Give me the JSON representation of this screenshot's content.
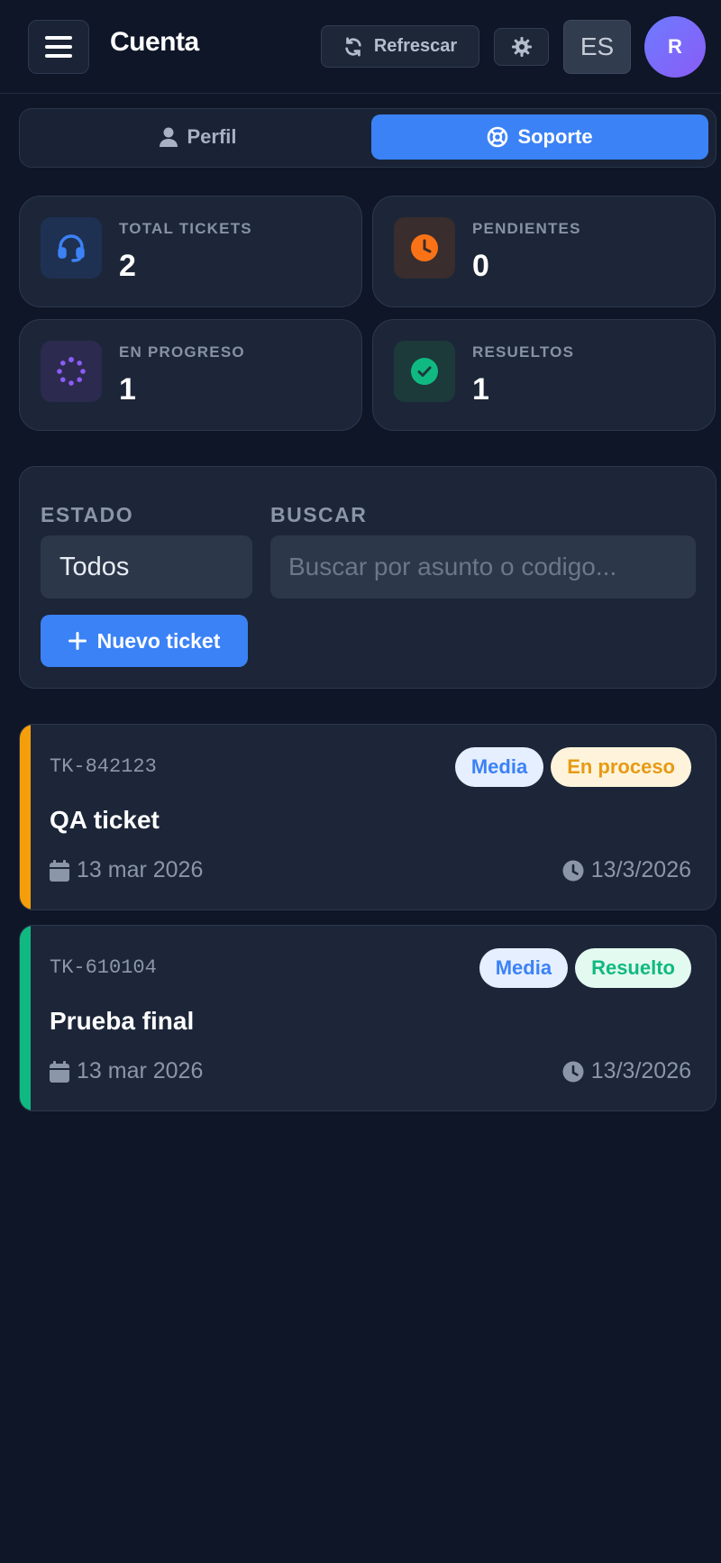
{
  "header": {
    "title": "Cuenta",
    "refresh_label": "Refrescar",
    "lang_label": "ES",
    "avatar_initial": "R"
  },
  "tabs": [
    {
      "label": "Perfil",
      "active": false,
      "icon": "user-icon"
    },
    {
      "label": "Soporte",
      "active": true,
      "icon": "lifebuoy-icon"
    }
  ],
  "stats": [
    {
      "label": "TOTAL TICKETS",
      "value": "2",
      "icon": "headset-icon",
      "color": "#3b82f6"
    },
    {
      "label": "PENDIENTES",
      "value": "0",
      "icon": "clock-icon",
      "color": "#f97316"
    },
    {
      "label": "EN PROGRESO",
      "value": "1",
      "icon": "spinner-icon",
      "color": "#8b5cf6"
    },
    {
      "label": "RESUELTOS",
      "value": "1",
      "icon": "check-circle-icon",
      "color": "#10b981"
    }
  ],
  "filters": {
    "status_label": "ESTADO",
    "status_value": "Todos",
    "search_label": "BUSCAR",
    "search_placeholder": "Buscar por asunto o codigo...",
    "search_value": "",
    "new_ticket_label": "Nuevo ticket"
  },
  "tickets": [
    {
      "code": "TK-842123",
      "title": "QA ticket",
      "priority": "Media",
      "status": "En proceso",
      "created": "13 mar 2026",
      "updated": "13/3/2026",
      "accent": "#f59e0b"
    },
    {
      "code": "TK-610104",
      "title": "Prueba final",
      "priority": "Media",
      "status": "Resuelto",
      "created": "13 mar 2026",
      "updated": "13/3/2026",
      "accent": "#10b981"
    }
  ],
  "colors": {
    "background": "#0e1628",
    "accent": "#3b82f6",
    "card": "#1c2638"
  }
}
